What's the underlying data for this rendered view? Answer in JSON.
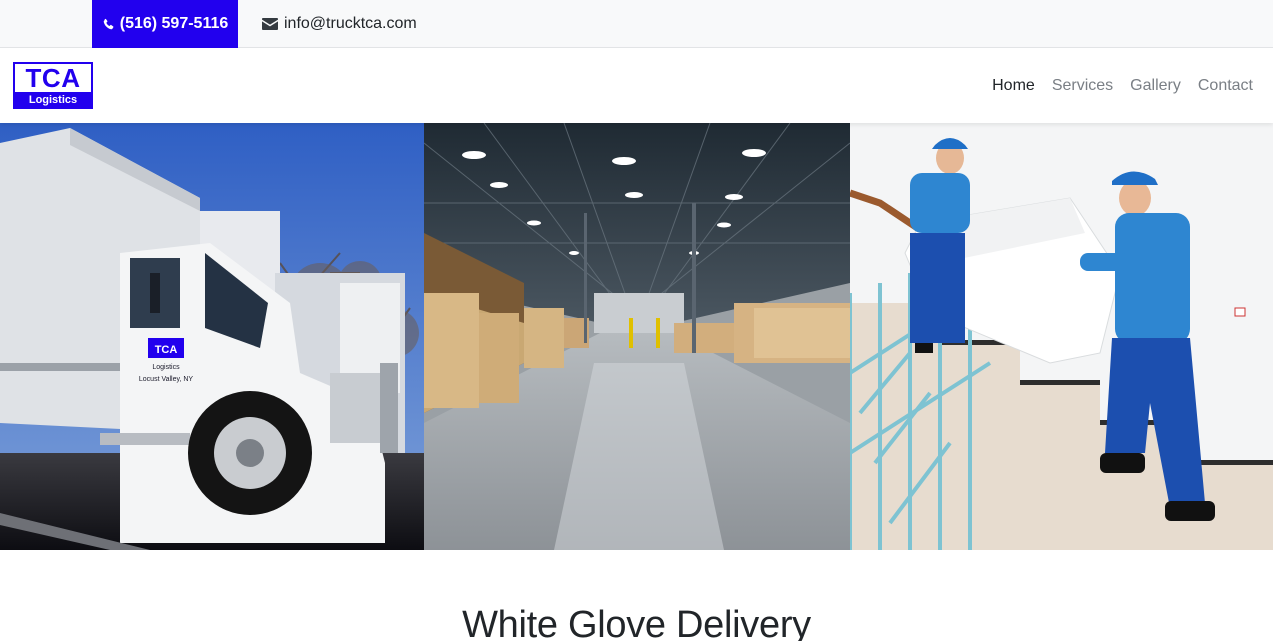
{
  "topbar": {
    "phone": "(516) 597-5116",
    "email": "info@trucktca.com",
    "phone_icon": "phone-icon",
    "email_icon": "envelope-icon",
    "accent_color": "#2200ee"
  },
  "brand": {
    "logo_main": "TCA",
    "logo_sub": "Logistics"
  },
  "nav": {
    "items": [
      {
        "label": "Home",
        "active": true
      },
      {
        "label": "Services",
        "active": false
      },
      {
        "label": "Gallery",
        "active": false
      },
      {
        "label": "Contact",
        "active": false
      }
    ]
  },
  "hero": {
    "images": [
      {
        "name": "truck-photo",
        "truck_logo_main": "TCA",
        "truck_logo_sub": "Logistics",
        "truck_text": "Locust Valley, NY"
      },
      {
        "name": "warehouse-photo"
      },
      {
        "name": "movers-photo"
      }
    ]
  },
  "section": {
    "title": "White Glove Delivery"
  }
}
